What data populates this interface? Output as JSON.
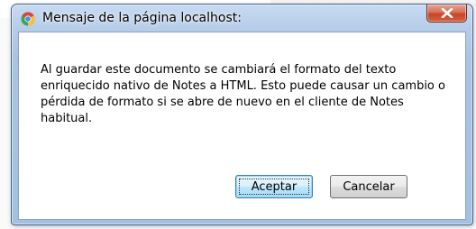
{
  "dialog": {
    "title": "Mensaje de la página localhost:",
    "message": "Al guardar este documento se cambiará el formato del texto enriquecido nativo de Notes a HTML. Esto puede causar un cambio o pérdida de formato si se abre de nuevo en el cliente de Notes habitual.",
    "buttons": {
      "accept_label": "Aceptar",
      "cancel_label": "Cancelar"
    },
    "icons": {
      "app_icon": "chrome-icon",
      "close_icon": "close-icon"
    }
  },
  "colors": {
    "frame": "#a9c3e3",
    "close_button": "#c8432a",
    "default_button_border": "#3c7fb1"
  }
}
